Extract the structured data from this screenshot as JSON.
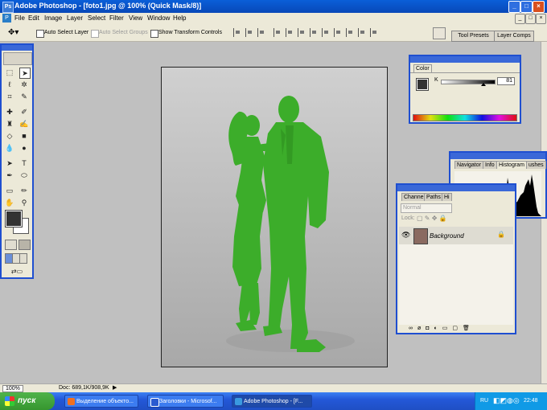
{
  "window": {
    "title": "Adobe Photoshop - [foto1.jpg @ 100% (Quick Mask/8)]",
    "min": "_",
    "max": "□",
    "close": "×",
    "doc_min": "_",
    "doc_max": "□",
    "doc_close": "×"
  },
  "menu": [
    "File",
    "Edit",
    "Image",
    "Layer",
    "Select",
    "Filter",
    "View",
    "Window",
    "Help"
  ],
  "options": {
    "auto_select_layer": "Auto Select Layer",
    "auto_select_groups": "Auto Select Groups",
    "show_transform": "Show Transform Controls",
    "tool_presets": "Tool Presets",
    "layer_comps": "Layer Comps"
  },
  "color_palette": {
    "tab": "Color",
    "channel": "K",
    "value": "81"
  },
  "histogram_palette": {
    "tabs": [
      "Navigator",
      "Info",
      "Histogram",
      "ushes"
    ]
  },
  "layers_palette": {
    "tabs": [
      "Channe",
      "Paths",
      "Hi"
    ],
    "blend_mode": "Normal",
    "lock_label": "Lock:",
    "layer_name": "Background"
  },
  "status": {
    "zoom": "100%",
    "doc": "Doc: 689,1K/908,9K"
  },
  "taskbar": {
    "start": "пуск",
    "buttons": [
      "Выделение объекто...",
      "Заголовки - Microsof...",
      "Adobe Photoshop - [F..."
    ],
    "lang": "RU",
    "clock": "22:48"
  },
  "colors": {
    "accent": "#1f4fd0",
    "mask": "#3cad2a",
    "canvas_bg": "#c8c8c8"
  }
}
